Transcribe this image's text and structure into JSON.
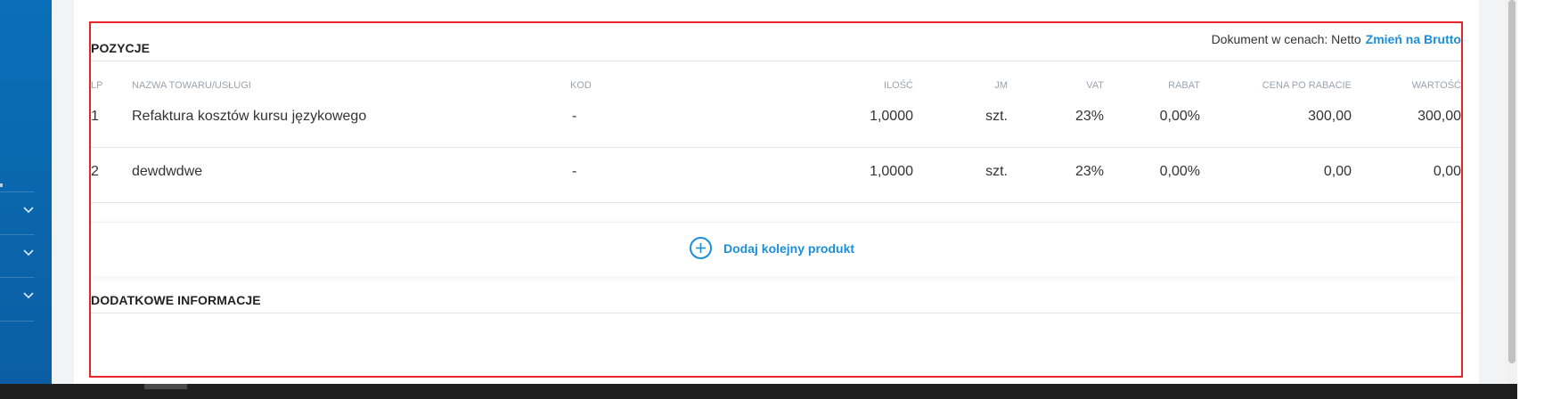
{
  "positions": {
    "title": "POZYCJE",
    "doc_prices_label": "Dokument w cenach: Netto",
    "switch_label": "Zmień na Brutto",
    "columns": {
      "lp": "LP",
      "name": "NAZWA TOWARU/USŁUGI",
      "code": "KOD",
      "qty": "ILOŚĆ",
      "unit": "JM",
      "vat": "VAT",
      "discount": "RABAT",
      "price_after": "CENA PO RABACIE",
      "value": "WARTOŚĆ"
    },
    "rows": [
      {
        "lp": "1",
        "name": "Refaktura kosztów kursu językowego",
        "code": "-",
        "qty": "1,0000",
        "unit": "szt.",
        "vat": "23%",
        "discount": "0,00%",
        "price_after": "300,00",
        "value": "300,00"
      },
      {
        "lp": "2",
        "name": "dewdwdwe",
        "code": "-",
        "qty": "1,0000",
        "unit": "szt.",
        "vat": "23%",
        "discount": "0,00%",
        "price_after": "0,00",
        "value": "0,00"
      }
    ],
    "add_product_label": "Dodaj kolejny produkt"
  },
  "additional": {
    "title": "DODATKOWE INFORMACJE"
  },
  "sidebar": {
    "items": [
      "collapsed-1",
      "collapsed-2",
      "collapsed-3"
    ]
  },
  "colors": {
    "accent": "#1b8fd8",
    "sidebar": "#0b66ad",
    "frame": "#e3242b"
  }
}
